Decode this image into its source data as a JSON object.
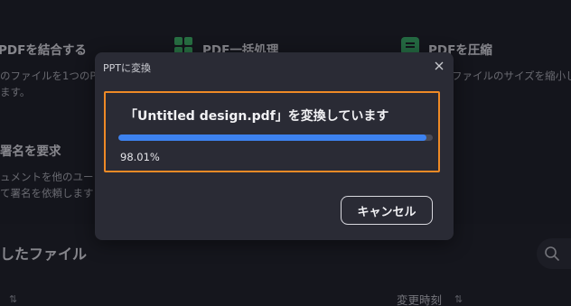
{
  "background": {
    "tools": [
      {
        "title": "PDFを結合する",
        "desc_lines": [
          "のファイルを1つのP",
          "ます。"
        ]
      },
      {
        "title": "PDF一括処理"
      },
      {
        "title": "PDFを圧縮",
        "desc_lines": [
          "ファイルのサイズを縮小し"
        ]
      },
      {
        "title": "署名を要求",
        "desc_lines": [
          "ュメントを他のユー",
          "て署名を依頼します"
        ]
      }
    ],
    "section_title": "したファイル",
    "columns": {
      "modified": "変更時刻"
    },
    "icons": {
      "grid": "grid-icon",
      "compress": "compress-icon",
      "search": "search-icon",
      "sort": "sort-icon"
    }
  },
  "dialog": {
    "title": "PPTに変換",
    "message": "「Untitled design.pdf」を変換しています",
    "progress": 0.9801,
    "progress_text": "98.01%",
    "cancel_label": "キャンセル",
    "colors": {
      "accent_border": "#ee8a26",
      "progress_fill": "#3d82f0"
    }
  }
}
